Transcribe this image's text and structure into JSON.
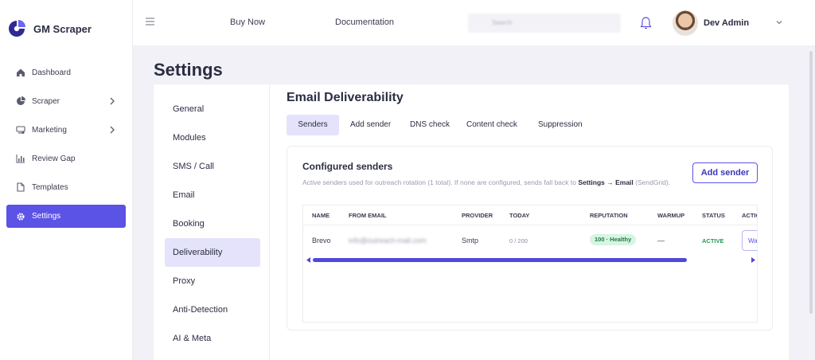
{
  "app": {
    "name": "GM Scraper",
    "brand_color": "#5b52e6"
  },
  "sidebar": {
    "items": [
      {
        "label": "Dashboard",
        "icon": "home-icon",
        "has_chevron": false
      },
      {
        "label": "Scraper",
        "icon": "pie-chart-icon",
        "has_chevron": true
      },
      {
        "label": "Marketing",
        "icon": "megaphone-icon",
        "has_chevron": true
      },
      {
        "label": "Review Gap",
        "icon": "bar-chart-icon",
        "has_chevron": false
      },
      {
        "label": "Templates",
        "icon": "file-icon",
        "has_chevron": false
      },
      {
        "label": "Settings",
        "icon": "gear-icon",
        "has_chevron": false,
        "active": true
      }
    ]
  },
  "header": {
    "buy_now": "Buy Now",
    "documentation": "Documentation",
    "search_placeholder": "Search",
    "user_name": "Dev Admin"
  },
  "page": {
    "title": "Settings"
  },
  "settings_nav": {
    "items": [
      "General",
      "Modules",
      "SMS / Call",
      "Email",
      "Booking",
      "Deliverability",
      "Proxy",
      "Anti-Detection",
      "AI & Meta"
    ],
    "active": "Deliverability"
  },
  "deliverability": {
    "title": "Email Deliverability",
    "tabs": [
      "Senders",
      "Add sender",
      "DNS check",
      "Content check",
      "Suppression"
    ],
    "active_tab": "Senders",
    "card": {
      "title": "Configured senders",
      "desc_prefix": "Active senders used for outreach rotation (1 total). If none are configured, sends fall back to ",
      "desc_link": "Settings → Email",
      "desc_suffix": " (SendGrid).",
      "add_button": "Add sender"
    },
    "table": {
      "columns": [
        "NAME",
        "FROM EMAIL",
        "PROVIDER",
        "TODAY",
        "REPUTATION",
        "WARMUP",
        "STATUS",
        "ACTIONS"
      ],
      "rows": [
        {
          "name": "Brevo",
          "from_email": "info@outreach-mail.com",
          "provider": "Smtp",
          "today": "0 / 200",
          "reputation": "100 · Healthy",
          "warmup": "—",
          "status": "ACTIVE",
          "action": "Warmup"
        }
      ]
    }
  }
}
